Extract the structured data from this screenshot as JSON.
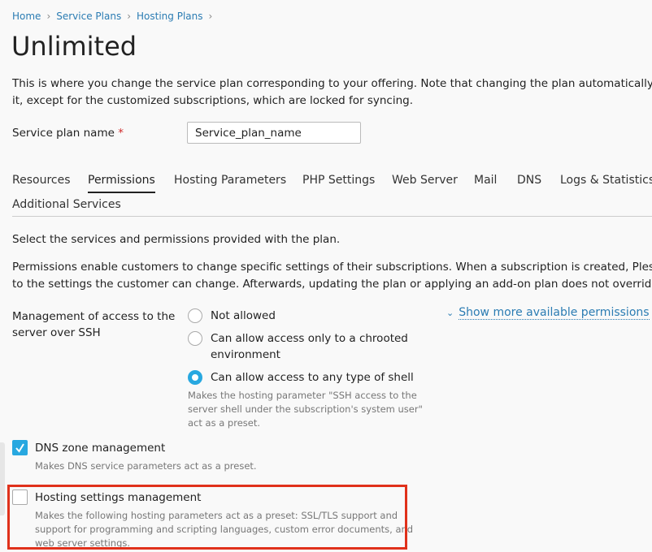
{
  "breadcrumb": [
    "Home",
    "Service Plans",
    "Hosting Plans"
  ],
  "title": "Unlimited",
  "intro": [
    "This is where you change the service plan corresponding to your offering. Note that changing the plan automatically upda",
    "it, except for the customized subscriptions, which are locked for syncing."
  ],
  "plan_name": {
    "label": "Service plan name",
    "required": "*",
    "value": "Service_plan_name"
  },
  "tabs": [
    "Resources",
    "Permissions",
    "Hosting Parameters",
    "PHP Settings",
    "Web Server",
    "Mail",
    "DNS",
    "Logs & Statistics",
    "Additional Services"
  ],
  "active_tab": "Permissions",
  "section_intro": "Select the services and permissions provided with the plan.",
  "permissions_text": [
    "Permissions enable customers to change specific settings of their subscriptions. When a subscription is created, Plesk app",
    "to the settings the customer can change. Afterwards, updating the plan or applying an add-on plan does not override cha"
  ],
  "ssh": {
    "label": [
      "Management of access to the",
      "server over SSH"
    ],
    "options": [
      "Not allowed",
      "Can allow access only to a chrooted",
      "environment",
      "Can allow access to any type of shell"
    ],
    "selected": "Can allow access to any type of shell",
    "hint": [
      "Makes the hosting parameter \"SSH access to the",
      "server shell under the subscription's system user\"",
      "act as a preset."
    ]
  },
  "show_more": "Show more available permissions",
  "dns": {
    "label": "DNS zone management",
    "checked": true,
    "hint": "Makes DNS service parameters act as a preset."
  },
  "hosting": {
    "label": "Hosting settings management",
    "checked": false,
    "hint": [
      "Makes the following hosting parameters act as a preset: SSL/TLS support and",
      "support for programming and scripting languages, custom error documents, and",
      "web server settings."
    ]
  },
  "colors": {
    "accent": "#28a8e0",
    "link": "#2b7cb3",
    "highlight": "#e0311b"
  }
}
